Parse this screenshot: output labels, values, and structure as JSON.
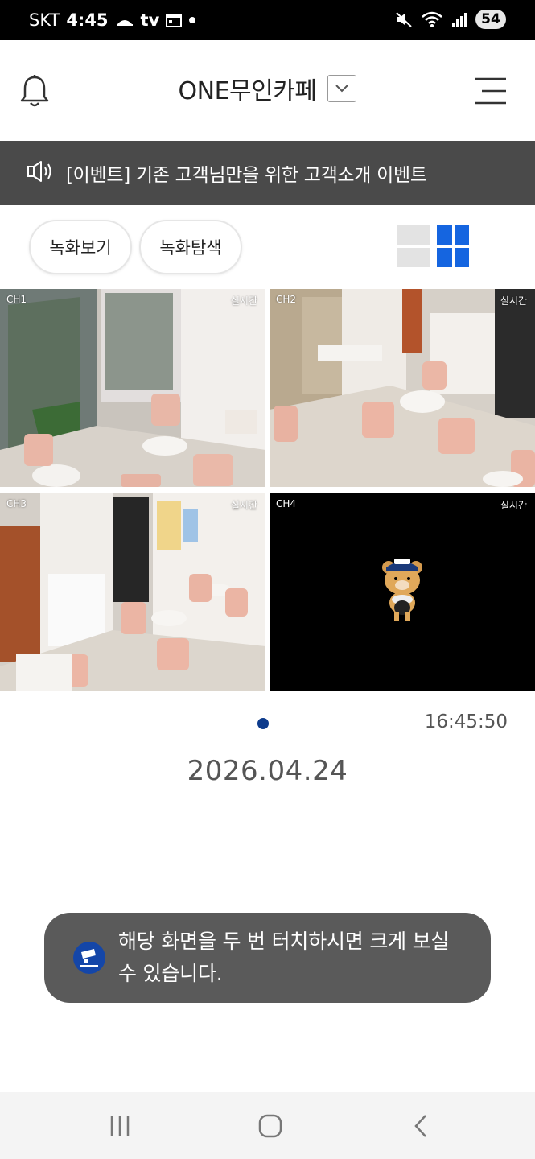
{
  "status_bar": {
    "carrier": "SKT",
    "time": "4:45",
    "tv_label": "tv",
    "battery": "54",
    "icons": [
      "cloud-icon",
      "tv-icon",
      "calendar-icon",
      "dot-icon",
      "mute-icon",
      "wifi-icon",
      "signal-icon",
      "battery-icon"
    ]
  },
  "header": {
    "title": "ONE무인카페",
    "icons": {
      "left": "bell-icon",
      "dropdown": "chevron-down-icon",
      "right": "menu-icon"
    }
  },
  "notice": {
    "text": "[이벤트] 기존 고객님만을 위한 고객소개 이벤트",
    "icon": "speaker-icon"
  },
  "toolbar": {
    "recording_view_label": "녹화보기",
    "recording_search_label": "녹화탐색",
    "view_modes": [
      "single-view-icon",
      "quad-view-icon"
    ],
    "active_color": "#1565e0"
  },
  "cameras": [
    {
      "label": "CH1",
      "live": "실시간"
    },
    {
      "label": "CH2",
      "live": "실시간"
    },
    {
      "label": "CH3",
      "live": "실시간"
    },
    {
      "label": "CH4",
      "live": "실시간"
    }
  ],
  "playback": {
    "time": "16:45:50",
    "date": "2026.04.24",
    "page_indicator_color": "#0d3b8c"
  },
  "toast": {
    "text": "해당 화면을 두 번 터치하시면 크게 보실 수 있습니다.",
    "icon": "app-logo-icon"
  },
  "nav_bar": {
    "icons": [
      "recent-apps-icon",
      "home-icon",
      "back-icon"
    ]
  }
}
